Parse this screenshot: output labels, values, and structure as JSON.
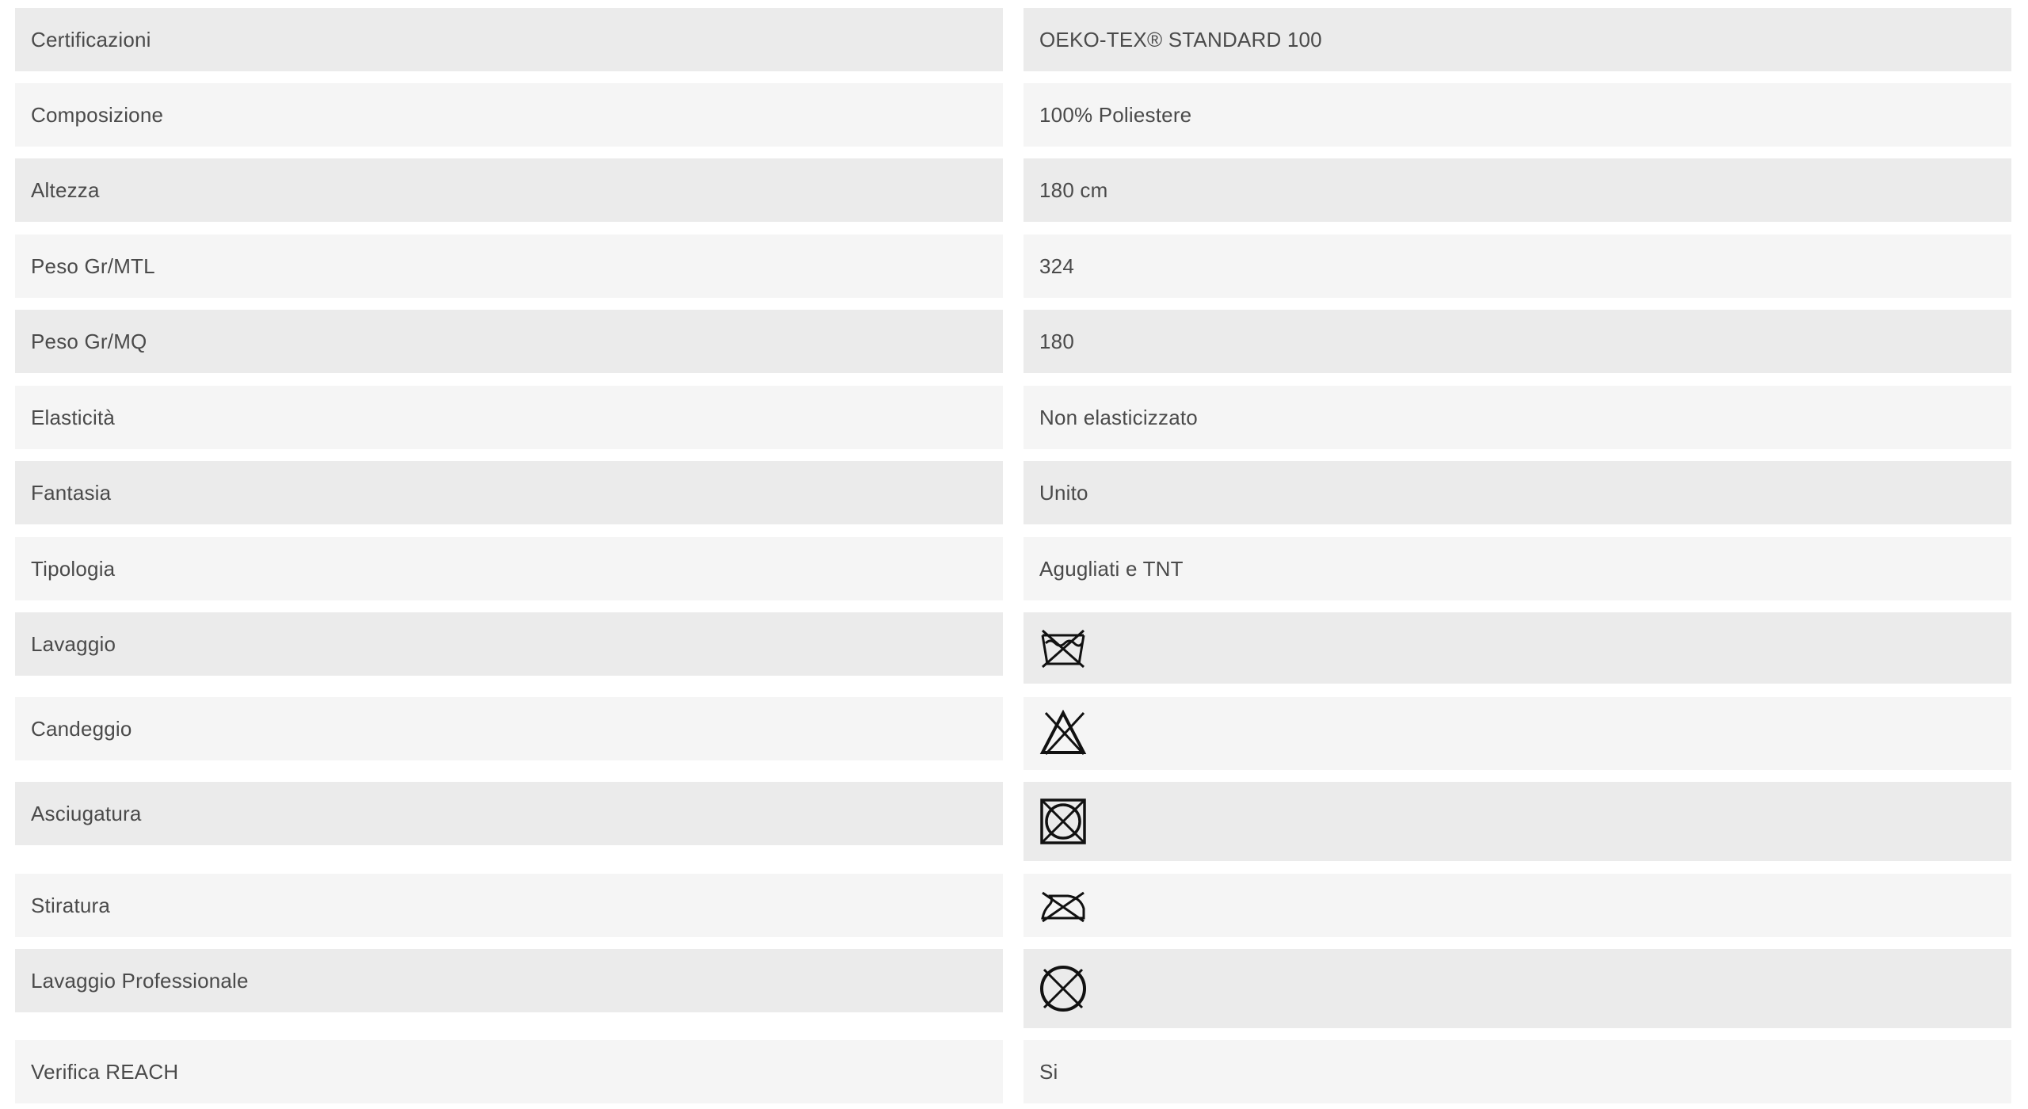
{
  "specs": {
    "rows": [
      {
        "label": "Certificazioni",
        "value": "OEKO-TEX® STANDARD 100"
      },
      {
        "label": "Composizione",
        "value": "100% Poliestere"
      },
      {
        "label": "Altezza",
        "value": "180 cm"
      },
      {
        "label": "Peso Gr/MTL",
        "value": "324"
      },
      {
        "label": "Peso Gr/MQ",
        "value": "180"
      },
      {
        "label": "Elasticità",
        "value": "Non elasticizzato"
      },
      {
        "label": "Fantasia",
        "value": "Unito"
      },
      {
        "label": "Tipologia",
        "value": "Agugliati e TNT"
      },
      {
        "label": "Lavaggio",
        "icon": "do-not-wash-icon"
      },
      {
        "label": "Candeggio",
        "icon": "do-not-bleach-icon"
      },
      {
        "label": "Asciugatura",
        "icon": "do-not-tumble-dry-icon"
      },
      {
        "label": "Stiratura",
        "icon": "do-not-iron-icon"
      },
      {
        "label": "Lavaggio Professionale",
        "icon": "do-not-dry-clean-icon"
      },
      {
        "label": "Verifica REACH",
        "value": "Si"
      }
    ]
  },
  "colors": {
    "row_dark": "#ebebeb",
    "row_light": "#f5f5f5",
    "text": "#4a4a4a",
    "icon": "#111111"
  }
}
